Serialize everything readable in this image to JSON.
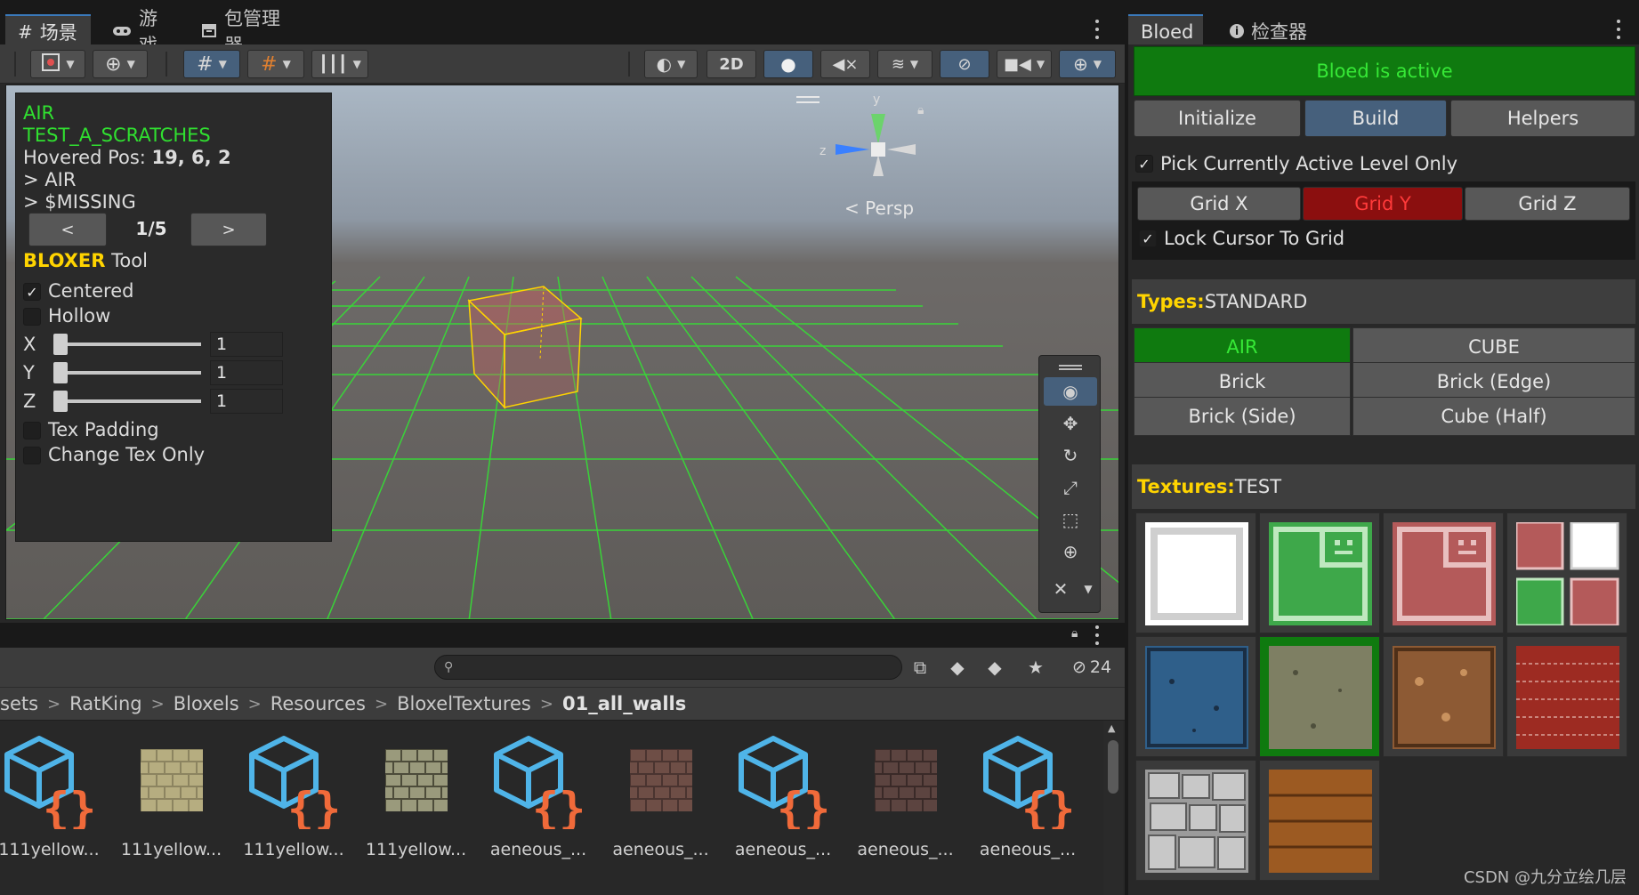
{
  "scene": {
    "tabs": [
      {
        "label": "场景",
        "icon": "hash-icon",
        "active": true
      },
      {
        "label": "游戏",
        "icon": "gamepad-icon",
        "active": false
      },
      {
        "label": "包管理器",
        "icon": "package-icon",
        "active": false
      }
    ],
    "toolbar": {
      "mode_2d": "2D"
    },
    "persp_label": "< Persp",
    "gizmo_axes": {
      "y": "y",
      "z": "z"
    }
  },
  "overlay": {
    "line1": "AIR",
    "line2": "TEST_A_SCRATCHES",
    "hovered_label": "Hovered Pos: ",
    "hovered_value": "19, 6, 2",
    "line4": "> AIR",
    "line5": "> $MISSING",
    "prev": "<",
    "page": "1/5",
    "next": ">",
    "tool_name": "BLOXER",
    "tool_suffix": " Tool",
    "centered": {
      "label": "Centered",
      "checked": true
    },
    "hollow": {
      "label": "Hollow",
      "checked": false
    },
    "x": {
      "label": "X",
      "value": "1"
    },
    "y": {
      "label": "Y",
      "value": "1"
    },
    "z": {
      "label": "Z",
      "value": "1"
    },
    "tex_padding": {
      "label": "Tex Padding",
      "checked": false
    },
    "change_tex_only": {
      "label": "Change Tex Only",
      "checked": false
    }
  },
  "project": {
    "hidden_count": "24",
    "breadcrumb": [
      "sets",
      "RatKing",
      "Bloxels",
      "Resources",
      "BloxelTextures",
      "01_all_walls"
    ],
    "assets": [
      {
        "label": "111yellow...",
        "kind": "script-icon"
      },
      {
        "label": "111yellow...",
        "kind": "texture-yellow-bricks"
      },
      {
        "label": "111yellow...",
        "kind": "script-icon"
      },
      {
        "label": "111yellow...",
        "kind": "texture-green-stones"
      },
      {
        "label": "aeneous_...",
        "kind": "script-icon"
      },
      {
        "label": "aeneous_...",
        "kind": "texture-brown-bricks"
      },
      {
        "label": "aeneous_...",
        "kind": "script-icon"
      },
      {
        "label": "aeneous_...",
        "kind": "texture-brown-bricks-dark"
      },
      {
        "label": "aeneous_...",
        "kind": "script-icon"
      }
    ]
  },
  "right": {
    "tabs": [
      {
        "label": "Bloed",
        "active": true
      },
      {
        "label": "检查器",
        "icon": "info-icon",
        "active": false
      }
    ],
    "active_text": "Bloed is active",
    "mode_buttons": [
      {
        "label": "Initialize",
        "active": false
      },
      {
        "label": "Build",
        "active": true
      },
      {
        "label": "Helpers",
        "active": false
      }
    ],
    "pick_active_level": {
      "label": "Pick Currently Active Level Only",
      "checked": true
    },
    "grid_buttons": [
      {
        "label": "Grid X",
        "active": false
      },
      {
        "label": "Grid Y",
        "active": true
      },
      {
        "label": "Grid Z",
        "active": false
      }
    ],
    "lock_cursor": {
      "label": "Lock Cursor To Grid",
      "checked": true
    },
    "types_label": "Types:",
    "types_value": " STANDARD",
    "types": [
      {
        "label": "AIR",
        "active": true
      },
      {
        "label": "CUBE",
        "active": false
      },
      {
        "label": "Brick",
        "active": false
      },
      {
        "label": "Brick (Edge)",
        "active": false
      },
      {
        "label": "Brick (Side)",
        "active": false
      },
      {
        "label": "Cube (Half)",
        "active": false
      }
    ],
    "textures_label": "Textures:",
    "textures_value": " TEST",
    "textures": [
      {
        "name": "white-frame",
        "active": false
      },
      {
        "name": "green-test",
        "active": false
      },
      {
        "name": "red-test",
        "active": false
      },
      {
        "name": "multi-small",
        "active": false
      },
      {
        "name": "blue-stone",
        "active": false
      },
      {
        "name": "mossy-stone",
        "active": true
      },
      {
        "name": "brown-rock",
        "active": false
      },
      {
        "name": "red-bricks",
        "active": false
      },
      {
        "name": "grey-cobbles",
        "active": false
      },
      {
        "name": "wood-planks",
        "active": false
      }
    ]
  },
  "watermark": "CSDN @九分立绘几层",
  "colors": {
    "accent_blue": "#46607c",
    "active_green": "#0f7a0f",
    "green_text": "#36e836",
    "grid_y_red": "#8b0f0f",
    "yellow_label": "#ffd400"
  }
}
